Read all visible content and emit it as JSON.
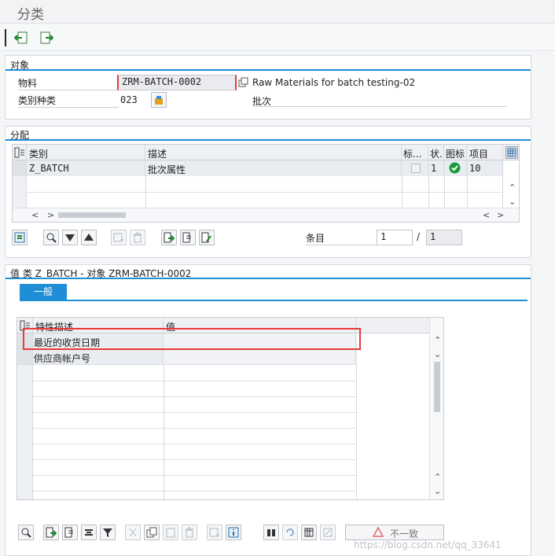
{
  "window": {
    "title": "分类"
  },
  "object_section": {
    "title": "对象",
    "material_label": "物料",
    "material_value": "ZRM-BATCH-0002",
    "material_desc": "Raw Materials for batch testing-02",
    "class_type_label": "类别种类",
    "class_type_value": "023",
    "class_type_desc": "批次"
  },
  "assignment_section": {
    "title": "分配",
    "columns": [
      "类别",
      "描述",
      "标...",
      "状.",
      "图标",
      "项目"
    ],
    "rows": [
      {
        "class": "Z_BATCH",
        "desc": "批次属性",
        "status": "1",
        "item": "10"
      }
    ],
    "entry_label": "条目",
    "entry_value": "1",
    "entry_sep": "/",
    "entry_total": "1"
  },
  "values_section": {
    "title": "值 类 Z_BATCH - 对象 ZRM-BATCH-0002",
    "tab_general": "一般",
    "columns": [
      "特性描述",
      "值"
    ],
    "rows": [
      {
        "char": "最近的收货日期",
        "value": ""
      },
      {
        "char": "供应商帐户号",
        "value": ""
      }
    ],
    "inconsistent_label": "不一致"
  },
  "colors": {
    "accent": "#1f8ed6",
    "highlight": "#e83a3a",
    "ok_green": "#1a9a3b"
  },
  "footer": {
    "watermark": "https://blog.csdn.net/qq_33641"
  }
}
